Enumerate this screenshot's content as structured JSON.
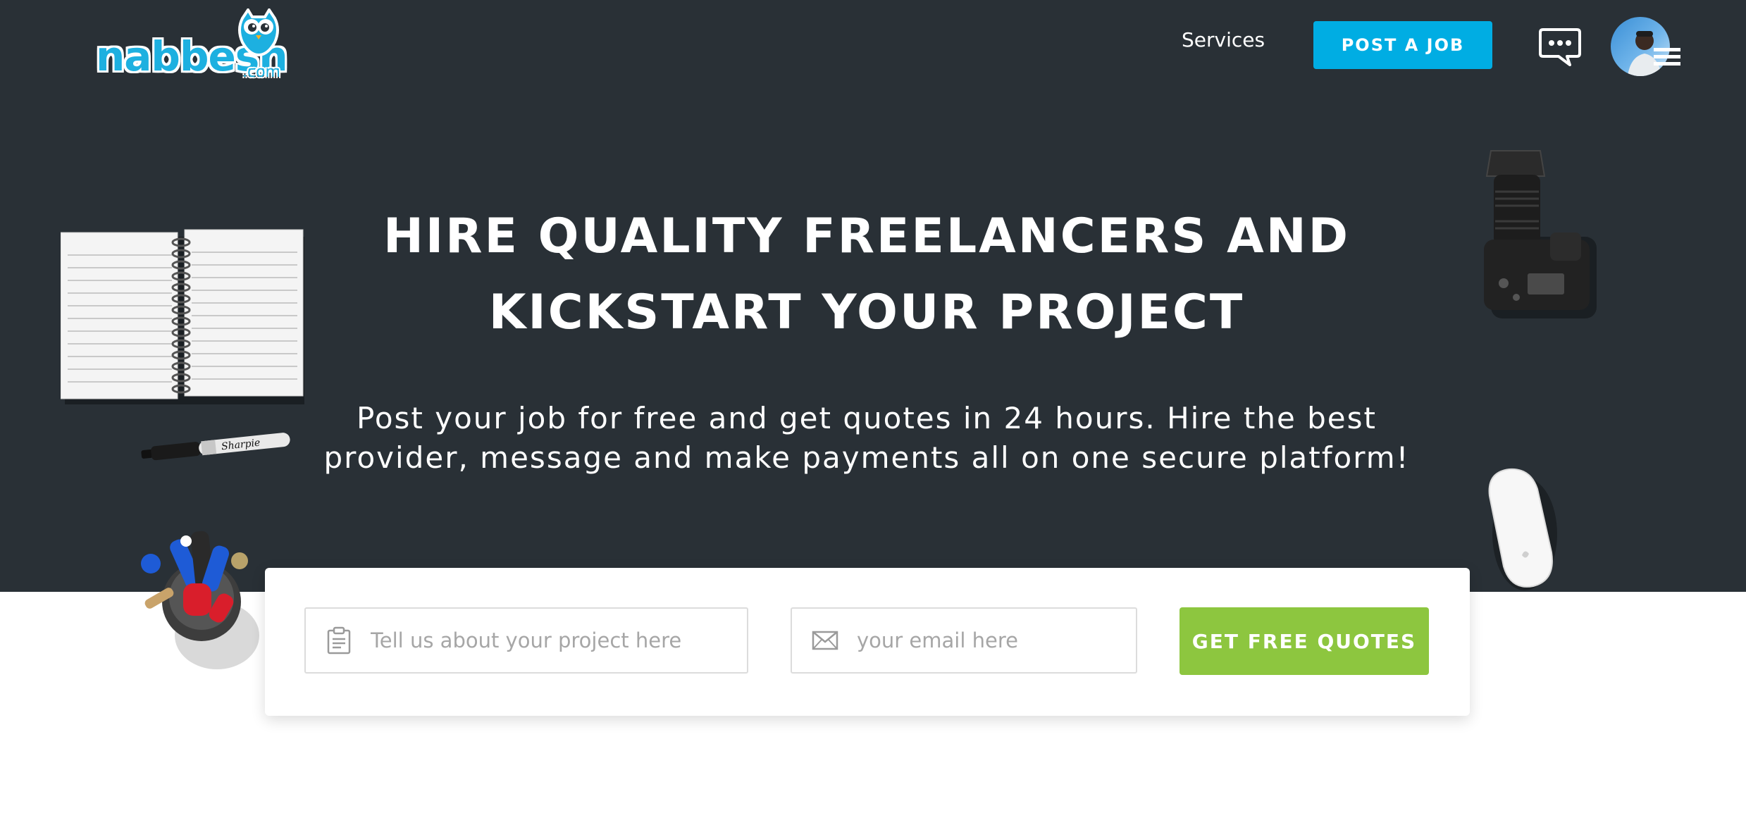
{
  "brand": {
    "name": "nabbesh",
    "suffix": ".com",
    "color": "#1db0e0"
  },
  "header": {
    "nav_services": "Services",
    "post_job_label": "POST A JOB",
    "post_job_color": "#00ade3",
    "chat_icon": "chat-bubble-icon",
    "menu_icon": "hamburger-menu-icon"
  },
  "hero": {
    "headline_line1": "HIRE QUALITY FREELANCERS AND",
    "headline_line2": "KICKSTART YOUR PROJECT",
    "subhead_line1": "Post your job for free and get quotes in 24 hours. Hire the best",
    "subhead_line2": "provider, message and make payments all on one secure platform!",
    "background": "#293036"
  },
  "form": {
    "project_placeholder": "Tell us about your project here",
    "project_icon": "clipboard-icon",
    "email_placeholder": "your email here",
    "email_icon": "envelope-icon",
    "submit_label": "GET FREE QUOTES",
    "submit_color": "#8dc63f"
  },
  "decor": {
    "marker_brand": "Sharpie"
  }
}
